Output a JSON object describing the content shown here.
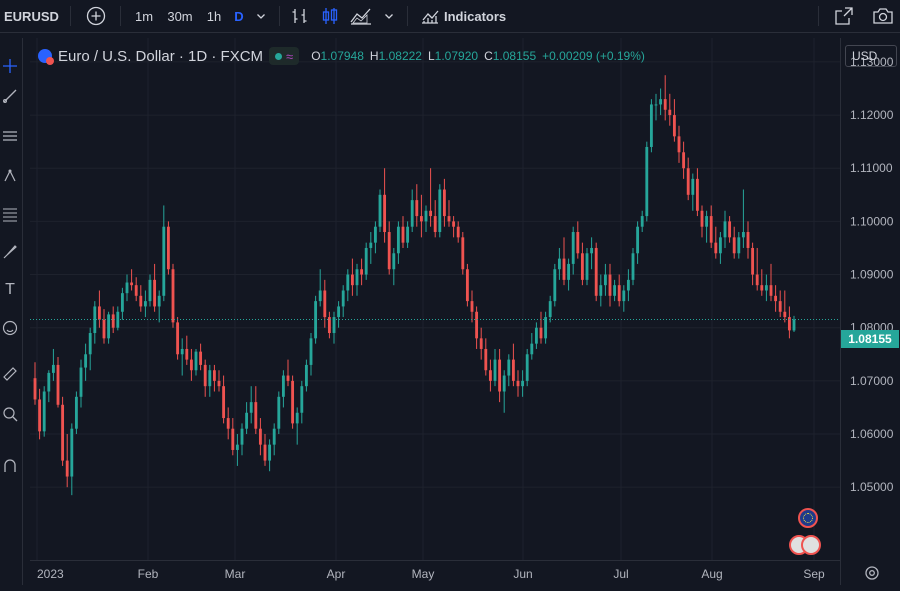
{
  "toolbar": {
    "symbol": "EURUSD",
    "intervals": [
      "1m",
      "30m",
      "1h",
      "D"
    ],
    "active_interval": "D",
    "indicators_label": "Indicators",
    "icons": [
      "plus-circle-icon",
      "chevron-down-icon",
      "bar-style-icon",
      "candle-style-icon",
      "area-style-icon",
      "chevron-down-icon",
      "indicators-icon",
      "snapshot-icon",
      "camera-icon"
    ]
  },
  "left_toolbar": {
    "icons": [
      "crosshair-icon",
      "trendline-icon",
      "horizontal-lines-icon",
      "nodes-icon",
      "fib-icon",
      "brush-icon",
      "text-icon",
      "emoji-icon",
      "ruler-icon",
      "zoom-icon",
      "magnet-icon"
    ]
  },
  "legend": {
    "title": "Euro / U.S. Dollar · 1D · FXCM",
    "o_label": "O",
    "o_value": "1.07948",
    "h_label": "H",
    "h_value": "1.08222",
    "l_label": "L",
    "l_value": "1.07920",
    "c_label": "C",
    "c_value": "1.08155",
    "change": "+0.00209 (+0.19%)"
  },
  "currency_selector": "USD",
  "last_price_label": "1.08155",
  "colors": {
    "up": "#26a69a",
    "down": "#ef5350",
    "background": "#131722",
    "grid": "#1e222d"
  },
  "chart_data": {
    "type": "candlestick",
    "ylim": [
      1.04,
      1.13
    ],
    "price_ticks": [
      "1.13000",
      "1.12000",
      "1.11000",
      "1.10000",
      "1.09000",
      "1.08000",
      "1.07000",
      "1.06000",
      "1.05000"
    ],
    "time_labels": [
      "2023",
      "Feb",
      "Mar",
      "Apr",
      "May",
      "Jun",
      "Jul",
      "Aug",
      "Sep"
    ],
    "last_price": 1.08155,
    "candles": [
      [
        1.0705,
        1.0735,
        1.0655,
        1.0665
      ],
      [
        1.0665,
        1.0685,
        1.059,
        1.0605
      ],
      [
        1.0605,
        1.069,
        1.0595,
        1.068
      ],
      [
        1.068,
        1.072,
        1.066,
        1.0715
      ],
      [
        1.0715,
        1.076,
        1.07,
        1.073
      ],
      [
        1.073,
        1.0745,
        1.065,
        1.0655
      ],
      [
        1.0655,
        1.067,
        1.054,
        1.055
      ],
      [
        1.055,
        1.06,
        1.05,
        1.052
      ],
      [
        1.052,
        1.062,
        1.0485,
        1.061
      ],
      [
        1.061,
        1.068,
        1.06,
        1.067
      ],
      [
        1.067,
        1.074,
        1.065,
        1.0725
      ],
      [
        1.0725,
        1.077,
        1.07,
        1.075
      ],
      [
        1.075,
        1.08,
        1.072,
        1.079
      ],
      [
        1.079,
        1.085,
        1.077,
        1.084
      ],
      [
        1.084,
        1.087,
        1.08,
        1.0815
      ],
      [
        1.0815,
        1.0835,
        1.077,
        1.078
      ],
      [
        1.078,
        1.083,
        1.077,
        1.0825
      ],
      [
        1.0825,
        1.084,
        1.079,
        1.08
      ],
      [
        1.08,
        1.084,
        1.0795,
        1.083
      ],
      [
        1.083,
        1.0875,
        1.0815,
        1.0865
      ],
      [
        1.0865,
        1.09,
        1.085,
        1.0885
      ],
      [
        1.0885,
        1.091,
        1.087,
        1.088
      ],
      [
        1.088,
        1.0895,
        1.085,
        1.086
      ],
      [
        1.086,
        1.088,
        1.083,
        1.084
      ],
      [
        1.084,
        1.087,
        1.082,
        1.085
      ],
      [
        1.085,
        1.09,
        1.084,
        1.089
      ],
      [
        1.089,
        1.092,
        1.083,
        1.084
      ],
      [
        1.084,
        1.087,
        1.081,
        1.086
      ],
      [
        1.086,
        1.103,
        1.085,
        1.099
      ],
      [
        1.099,
        1.1,
        1.09,
        1.091
      ],
      [
        1.091,
        1.092,
        1.08,
        1.081
      ],
      [
        1.081,
        1.082,
        1.074,
        1.075
      ],
      [
        1.075,
        1.078,
        1.071,
        1.076
      ],
      [
        1.076,
        1.0785,
        1.073,
        1.074
      ],
      [
        1.074,
        1.076,
        1.07,
        1.072
      ],
      [
        1.072,
        1.076,
        1.071,
        1.0755
      ],
      [
        1.0755,
        1.077,
        1.072,
        1.073
      ],
      [
        1.073,
        1.074,
        1.067,
        1.069
      ],
      [
        1.069,
        1.073,
        1.067,
        1.072
      ],
      [
        1.072,
        1.073,
        1.068,
        1.07
      ],
      [
        1.07,
        1.072,
        1.068,
        1.069
      ],
      [
        1.069,
        1.071,
        1.062,
        1.063
      ],
      [
        1.063,
        1.065,
        1.059,
        1.061
      ],
      [
        1.061,
        1.063,
        1.056,
        1.057
      ],
      [
        1.057,
        1.06,
        1.054,
        1.058
      ],
      [
        1.058,
        1.062,
        1.056,
        1.061
      ],
      [
        1.061,
        1.066,
        1.06,
        1.064
      ],
      [
        1.064,
        1.069,
        1.062,
        1.066
      ],
      [
        1.066,
        1.069,
        1.06,
        1.061
      ],
      [
        1.061,
        1.063,
        1.056,
        1.058
      ],
      [
        1.058,
        1.06,
        1.054,
        1.055
      ],
      [
        1.055,
        1.059,
        1.053,
        1.058
      ],
      [
        1.058,
        1.062,
        1.056,
        1.061
      ],
      [
        1.061,
        1.068,
        1.06,
        1.067
      ],
      [
        1.067,
        1.072,
        1.065,
        1.071
      ],
      [
        1.071,
        1.074,
        1.069,
        1.07
      ],
      [
        1.07,
        1.071,
        1.061,
        1.062
      ],
      [
        1.062,
        1.065,
        1.058,
        1.064
      ],
      [
        1.064,
        1.07,
        1.062,
        1.069
      ],
      [
        1.069,
        1.074,
        1.068,
        1.073
      ],
      [
        1.073,
        1.079,
        1.071,
        1.078
      ],
      [
        1.078,
        1.086,
        1.077,
        1.085
      ],
      [
        1.085,
        1.091,
        1.084,
        1.087
      ],
      [
        1.087,
        1.089,
        1.08,
        1.082
      ],
      [
        1.082,
        1.083,
        1.078,
        1.079
      ],
      [
        1.079,
        1.083,
        1.077,
        1.082
      ],
      [
        1.082,
        1.085,
        1.08,
        1.084
      ],
      [
        1.084,
        1.088,
        1.082,
        1.087
      ],
      [
        1.087,
        1.091,
        1.085,
        1.09
      ],
      [
        1.09,
        1.093,
        1.086,
        1.088
      ],
      [
        1.088,
        1.092,
        1.086,
        1.091
      ],
      [
        1.091,
        1.093,
        1.088,
        1.09
      ],
      [
        1.09,
        1.096,
        1.089,
        1.095
      ],
      [
        1.095,
        1.098,
        1.092,
        1.096
      ],
      [
        1.096,
        1.1,
        1.094,
        1.099
      ],
      [
        1.099,
        1.106,
        1.098,
        1.105
      ],
      [
        1.105,
        1.11,
        1.096,
        1.098
      ],
      [
        1.098,
        1.1,
        1.09,
        1.091
      ],
      [
        1.091,
        1.095,
        1.088,
        1.094
      ],
      [
        1.094,
        1.1,
        1.092,
        1.099
      ],
      [
        1.099,
        1.101,
        1.095,
        1.096
      ],
      [
        1.096,
        1.1,
        1.095,
        1.099
      ],
      [
        1.099,
        1.106,
        1.098,
        1.104
      ],
      [
        1.104,
        1.107,
        1.099,
        1.101
      ],
      [
        1.101,
        1.105,
        1.097,
        1.1
      ],
      [
        1.1,
        1.103,
        1.098,
        1.102
      ],
      [
        1.102,
        1.11,
        1.099,
        1.101
      ],
      [
        1.101,
        1.104,
        1.097,
        1.098
      ],
      [
        1.098,
        1.107,
        1.097,
        1.106
      ],
      [
        1.106,
        1.108,
        1.099,
        1.101
      ],
      [
        1.101,
        1.104,
        1.099,
        1.1
      ],
      [
        1.1,
        1.101,
        1.097,
        1.099
      ],
      [
        1.099,
        1.1,
        1.096,
        1.097
      ],
      [
        1.097,
        1.098,
        1.09,
        1.091
      ],
      [
        1.091,
        1.092,
        1.084,
        1.085
      ],
      [
        1.085,
        1.087,
        1.081,
        1.083
      ],
      [
        1.083,
        1.084,
        1.076,
        1.078
      ],
      [
        1.078,
        1.08,
        1.074,
        1.076
      ],
      [
        1.076,
        1.078,
        1.071,
        1.072
      ],
      [
        1.072,
        1.074,
        1.068,
        1.07
      ],
      [
        1.07,
        1.076,
        1.069,
        1.074
      ],
      [
        1.074,
        1.076,
        1.066,
        1.068
      ],
      [
        1.068,
        1.072,
        1.064,
        1.071
      ],
      [
        1.071,
        1.075,
        1.069,
        1.074
      ],
      [
        1.074,
        1.077,
        1.069,
        1.07
      ],
      [
        1.07,
        1.072,
        1.067,
        1.069
      ],
      [
        1.069,
        1.072,
        1.067,
        1.07
      ],
      [
        1.07,
        1.076,
        1.069,
        1.075
      ],
      [
        1.075,
        1.079,
        1.074,
        1.077
      ],
      [
        1.077,
        1.081,
        1.076,
        1.08
      ],
      [
        1.08,
        1.083,
        1.077,
        1.078
      ],
      [
        1.078,
        1.083,
        1.077,
        1.082
      ],
      [
        1.082,
        1.086,
        1.081,
        1.085
      ],
      [
        1.085,
        1.092,
        1.084,
        1.091
      ],
      [
        1.091,
        1.095,
        1.089,
        1.093
      ],
      [
        1.093,
        1.097,
        1.088,
        1.089
      ],
      [
        1.089,
        1.093,
        1.087,
        1.092
      ],
      [
        1.092,
        1.099,
        1.09,
        1.098
      ],
      [
        1.098,
        1.1,
        1.093,
        1.094
      ],
      [
        1.094,
        1.096,
        1.088,
        1.089
      ],
      [
        1.089,
        1.095,
        1.088,
        1.094
      ],
      [
        1.094,
        1.097,
        1.091,
        1.095
      ],
      [
        1.095,
        1.096,
        1.085,
        1.086
      ],
      [
        1.086,
        1.09,
        1.084,
        1.088
      ],
      [
        1.088,
        1.092,
        1.086,
        1.09
      ],
      [
        1.09,
        1.092,
        1.084,
        1.086
      ],
      [
        1.086,
        1.089,
        1.085,
        1.088
      ],
      [
        1.088,
        1.09,
        1.084,
        1.085
      ],
      [
        1.085,
        1.088,
        1.083,
        1.087
      ],
      [
        1.087,
        1.091,
        1.085,
        1.089
      ],
      [
        1.089,
        1.095,
        1.088,
        1.094
      ],
      [
        1.094,
        1.1,
        1.092,
        1.099
      ],
      [
        1.099,
        1.102,
        1.098,
        1.101
      ],
      [
        1.101,
        1.115,
        1.1,
        1.114
      ],
      [
        1.114,
        1.123,
        1.113,
        1.122
      ],
      [
        1.122,
        1.124,
        1.119,
        1.122
      ],
      [
        1.122,
        1.125,
        1.12,
        1.123
      ],
      [
        1.123,
        1.1275,
        1.119,
        1.121
      ],
      [
        1.121,
        1.124,
        1.118,
        1.12
      ],
      [
        1.12,
        1.123,
        1.115,
        1.116
      ],
      [
        1.116,
        1.118,
        1.111,
        1.113
      ],
      [
        1.113,
        1.115,
        1.108,
        1.11
      ],
      [
        1.11,
        1.112,
        1.104,
        1.105
      ],
      [
        1.105,
        1.109,
        1.102,
        1.108
      ],
      [
        1.108,
        1.11,
        1.101,
        1.102
      ],
      [
        1.102,
        1.103,
        1.097,
        1.099
      ],
      [
        1.099,
        1.102,
        1.096,
        1.101
      ],
      [
        1.101,
        1.103,
        1.095,
        1.096
      ],
      [
        1.096,
        1.099,
        1.093,
        1.094
      ],
      [
        1.094,
        1.098,
        1.092,
        1.097
      ],
      [
        1.097,
        1.102,
        1.095,
        1.1
      ],
      [
        1.1,
        1.101,
        1.096,
        1.097
      ],
      [
        1.097,
        1.099,
        1.093,
        1.094
      ],
      [
        1.094,
        1.098,
        1.093,
        1.097
      ],
      [
        1.097,
        1.106,
        1.095,
        1.098
      ],
      [
        1.098,
        1.1,
        1.093,
        1.095
      ],
      [
        1.095,
        1.096,
        1.088,
        1.09
      ],
      [
        1.09,
        1.095,
        1.087,
        1.088
      ],
      [
        1.088,
        1.091,
        1.086,
        1.087
      ],
      [
        1.087,
        1.09,
        1.085,
        1.088
      ],
      [
        1.088,
        1.092,
        1.085,
        1.086
      ],
      [
        1.086,
        1.088,
        1.083,
        1.085
      ],
      [
        1.085,
        1.087,
        1.082,
        1.083
      ],
      [
        1.083,
        1.087,
        1.081,
        1.082
      ],
      [
        1.082,
        1.084,
        1.078,
        1.0795
      ],
      [
        1.07948,
        1.08222,
        1.0792,
        1.08155
      ]
    ]
  }
}
